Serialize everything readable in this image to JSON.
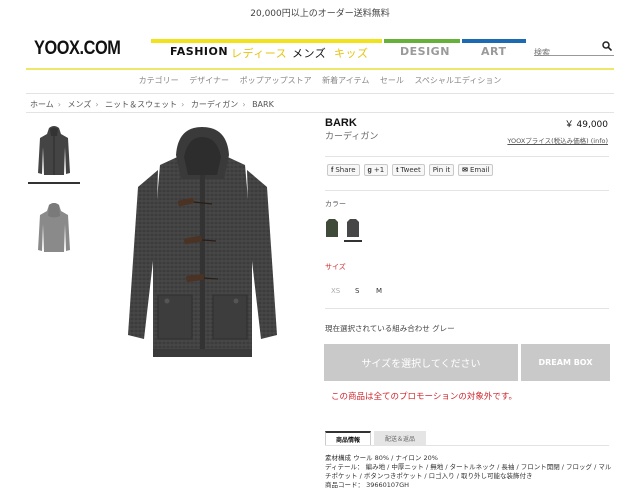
{
  "promo_banner": "20,000円以上のオーダー送料無料",
  "header": {
    "logo": "YOOX.COM",
    "nav": {
      "fashion": "FASHION",
      "ladies": "レディース",
      "mens": "メンズ",
      "kids": "キッズ",
      "design": "DESIGN",
      "art": "ART"
    },
    "search_placeholder": "検索"
  },
  "subnav": [
    "カテゴリー",
    "デザイナー",
    "ポップアップストア",
    "新着アイテム",
    "セール",
    "スペシャルエディション"
  ],
  "breadcrumb": [
    "ホーム",
    "メンズ",
    "ニット＆スウェット",
    "カーディガン",
    "BARK"
  ],
  "product": {
    "brand": "BARK",
    "category": "カーディガン",
    "price": "￥ 49,000",
    "price_info": "YOOXプライス(税込み価格) (info)",
    "social": {
      "share": "Share",
      "gplus": "+1",
      "tweet": "Tweet",
      "pin": "Pin it",
      "email": "Email"
    },
    "color_label": "カラー",
    "size_label": "サイズ",
    "sizes": [
      "XS",
      "S",
      "M"
    ],
    "combination": "現在選択されている組み合わせ グレー",
    "select_size_button": "サイズを選択してください",
    "dream_box_button": "DREAM BOX",
    "promo_note": "この商品は全てのプロモーションの対象外です。",
    "tabs": [
      "商品情報",
      "配送＆返品"
    ],
    "details": {
      "composition": "素材構成 ウール 80% / ナイロン 20%",
      "detail_line": "ディテール： 編み地 / 中厚ニット / 無地 / タートルネック / 長袖 / フロント開閉 / フロッグ / マルチポケット / ボタンつきポケット / ロゴ入り / 取り外し可能な装飾付き",
      "code": "商品コード： 39660107GH"
    }
  },
  "colors": {
    "accent_yellow": "#f0e31b",
    "design_green": "#65b13a",
    "art_blue": "#1c6ab2",
    "promo_red": "#d0262d",
    "button_gray": "#c9c9c9"
  }
}
